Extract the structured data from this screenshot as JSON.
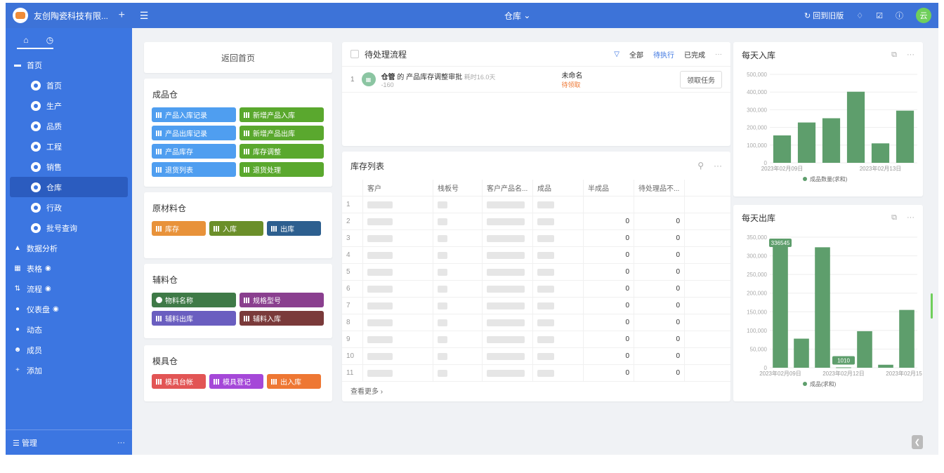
{
  "sidebar": {
    "company": "友创陶瓷科技有限...",
    "menu": [
      {
        "label": "首页"
      },
      {
        "label": "首页"
      },
      {
        "label": "生产"
      },
      {
        "label": "品质"
      },
      {
        "label": "工程"
      },
      {
        "label": "销售"
      },
      {
        "label": "仓库"
      },
      {
        "label": "行政"
      },
      {
        "label": "批号查询"
      },
      {
        "label": "数据分析"
      },
      {
        "label": "表格"
      },
      {
        "label": "流程"
      },
      {
        "label": "仪表盘"
      },
      {
        "label": "动态"
      },
      {
        "label": "成员"
      },
      {
        "label": "添加"
      }
    ],
    "manage": "管理"
  },
  "topbar": {
    "center_title": "仓库",
    "back_old": "回到旧版",
    "avatar": "云"
  },
  "home_button": "返回首页",
  "groups": [
    {
      "title": "成品仓",
      "buttons": [
        {
          "label": "产品入库记录",
          "color": "#4f9ef0"
        },
        {
          "label": "新增产品入库",
          "color": "#5aa82e"
        },
        {
          "label": "产品出库记录",
          "color": "#4f9ef0"
        },
        {
          "label": "新增产品出库",
          "color": "#5aa82e"
        },
        {
          "label": "产品库存",
          "color": "#4f9ef0"
        },
        {
          "label": "库存调整",
          "color": "#5aa82e"
        },
        {
          "label": "退货列表",
          "color": "#4f9ef0"
        },
        {
          "label": "退货处理",
          "color": "#5aa82e"
        }
      ]
    },
    {
      "title": "原材料仓",
      "buttons": [
        {
          "label": "库存",
          "color": "#e8923a"
        },
        {
          "label": "入库",
          "color": "#6b8f2a"
        },
        {
          "label": "出库",
          "color": "#2d5f8f"
        }
      ]
    },
    {
      "title": "辅料仓",
      "buttons": [
        {
          "label": "物料名称",
          "color": "#3f7a47"
        },
        {
          "label": "规格型号",
          "color": "#8a3f8f"
        },
        {
          "label": "辅料出库",
          "color": "#6a5ec0"
        },
        {
          "label": "辅料入库",
          "color": "#7a3a3a"
        }
      ]
    },
    {
      "title": "模具仓",
      "buttons": [
        {
          "label": "模具台帐",
          "color": "#e25555"
        },
        {
          "label": "模具登记",
          "color": "#a548d8"
        },
        {
          "label": "出入库",
          "color": "#ee7733"
        }
      ]
    }
  ],
  "pending": {
    "title": "待处理流程",
    "filters": [
      "全部",
      "待执行",
      "已完成"
    ],
    "task": {
      "index": "1",
      "owner": "仓管",
      "connector": "的",
      "name": "产品库存调整审批",
      "elapsed": "耗时16.0天",
      "sub": "-160",
      "assignee": "未命名",
      "status": "待领取",
      "action": "领取任务"
    }
  },
  "inventory": {
    "title": "库存列表",
    "columns": [
      "客户",
      "栈板号",
      "客户产品名...",
      "成品",
      "半成品",
      "待处理品不..."
    ],
    "rows": [
      {
        "n": "1",
        "semi": "",
        "pending": ""
      },
      {
        "n": "2",
        "semi": "0",
        "pending": "0"
      },
      {
        "n": "3",
        "semi": "0",
        "pending": "0"
      },
      {
        "n": "4",
        "semi": "0",
        "pending": "0"
      },
      {
        "n": "5",
        "semi": "0",
        "pending": "0"
      },
      {
        "n": "6",
        "semi": "0",
        "pending": "0"
      },
      {
        "n": "7",
        "semi": "0",
        "pending": "0"
      },
      {
        "n": "8",
        "semi": "0",
        "pending": "0"
      },
      {
        "n": "9",
        "semi": "0",
        "pending": "0"
      },
      {
        "n": "10",
        "semi": "0",
        "pending": "0"
      },
      {
        "n": "11",
        "semi": "0",
        "pending": "0"
      }
    ],
    "more": "查看更多"
  },
  "chart_data": [
    {
      "type": "bar",
      "title": "每天入库",
      "categories": [
        "2023年02月09日",
        "",
        "",
        "",
        "2023年02月13日",
        ""
      ],
      "values": [
        155000,
        228000,
        252000,
        402000,
        110000,
        295000
      ],
      "ylim": [
        0,
        500000
      ],
      "yticks": [
        "0",
        "100,000",
        "200,000",
        "300,000",
        "400,000",
        "500,000"
      ],
      "legend": "成品数量(求和)",
      "color": "#5e9e6c"
    },
    {
      "type": "bar",
      "title": "每天出库",
      "categories": [
        "2023年02月09日",
        "",
        "",
        "2023年02月12日",
        "",
        "",
        "2023年02月15日"
      ],
      "values": [
        336545,
        78000,
        323000,
        1010,
        98000,
        8000,
        155000
      ],
      "ylim": [
        0,
        350000
      ],
      "yticks": [
        "0",
        "50,000",
        "100,000",
        "150,000",
        "200,000",
        "250,000",
        "300,000",
        "350,000"
      ],
      "labels": [
        "336545",
        "1010"
      ],
      "legend": "成品(求和)",
      "color": "#5e9e6c"
    }
  ]
}
